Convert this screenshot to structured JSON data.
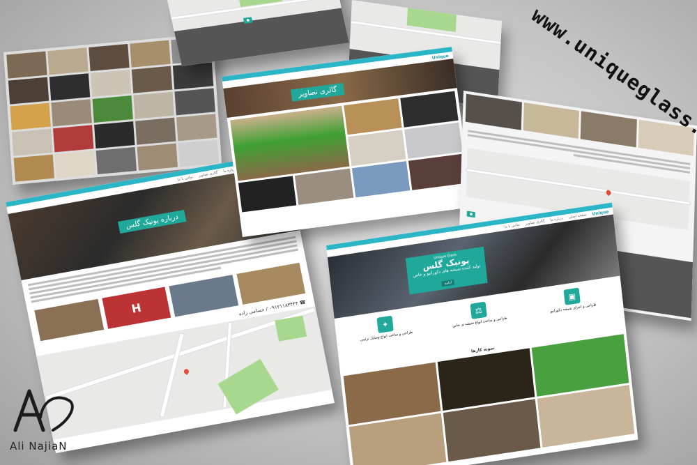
{
  "watermark": {
    "url": "www.uniqueglass.co"
  },
  "author": {
    "name": "Ali NajiaN",
    "logo_icon": "an-monogram-logo"
  },
  "site": {
    "logo_text": "Unique",
    "nav_items": [
      "صفحه اصلی",
      "درباره ما",
      "گالری تصاویر",
      "تماس با ما"
    ],
    "about_title": "درباره یونیک گلس",
    "gallery_title": "گالری تصاویر",
    "home_brand": "یونیک گلس",
    "home_subtitle_en": "Unique Glass",
    "home_tagline": "تولید کننده شیشه های دکوراتیو و خاص",
    "home_button": "ادامه",
    "features": [
      {
        "title": "طراحی و اجرای شیشه دکوراتیو",
        "icon": "sofa-icon"
      },
      {
        "title": "طراحی و ساخت انواع شیشه ی خاص",
        "icon": "glass-icon"
      },
      {
        "title": "طراحی و ساخت انواع وسایل تزئینی",
        "icon": "lamp-icon"
      }
    ],
    "samples_title": "نمونه کارها",
    "contact_phone": "۰۹۱۲۱۱۸۳۴۴۴",
    "contact_name": "حسامی زاده"
  },
  "colors": {
    "accent": "#2bb6c7",
    "teal": "#20a89b",
    "footer": "#555555"
  }
}
